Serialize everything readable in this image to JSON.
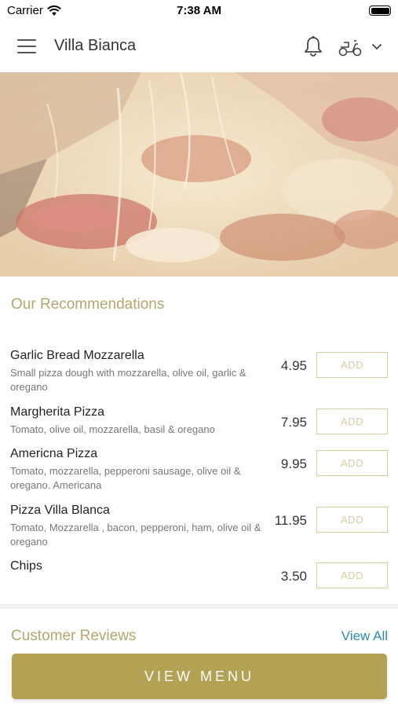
{
  "status_bar": {
    "carrier": "Carrier",
    "time": "7:38 AM"
  },
  "nav": {
    "title": "Villa Bianca"
  },
  "recommendations": {
    "title": "Our Recommendations",
    "items": [
      {
        "name": "Garlic Bread Mozzarella",
        "description": "Small pizza dough with mozzarella, olive oil, garlic & oregano",
        "price": "4.95",
        "add_label": "ADD"
      },
      {
        "name": "Margherita Pizza",
        "description": "Tomato, olive oil, mozzarella, basil & oregano",
        "price": "7.95",
        "add_label": "ADD"
      },
      {
        "name": "Americna Pizza",
        "description": "Tomato, mozzarella, pepperoni sausage, olive oil & oregano. Americana",
        "price": "9.95",
        "add_label": "ADD"
      },
      {
        "name": "Pizza Villa Blanca",
        "description": "Tomato, Mozzarella , bacon, pepperoni, ham, olive oil & oregano",
        "price": "11.95",
        "add_label": "ADD"
      },
      {
        "name": "Chips",
        "description": "",
        "price": "3.50",
        "add_label": "ADD"
      }
    ]
  },
  "reviews": {
    "title": "Customer Reviews",
    "view_all": "View All"
  },
  "cta": {
    "label": "VIEW MENU"
  },
  "colors": {
    "accent": "#b3a154",
    "link": "#2a8bb0",
    "section_title": "#b3a66e"
  }
}
